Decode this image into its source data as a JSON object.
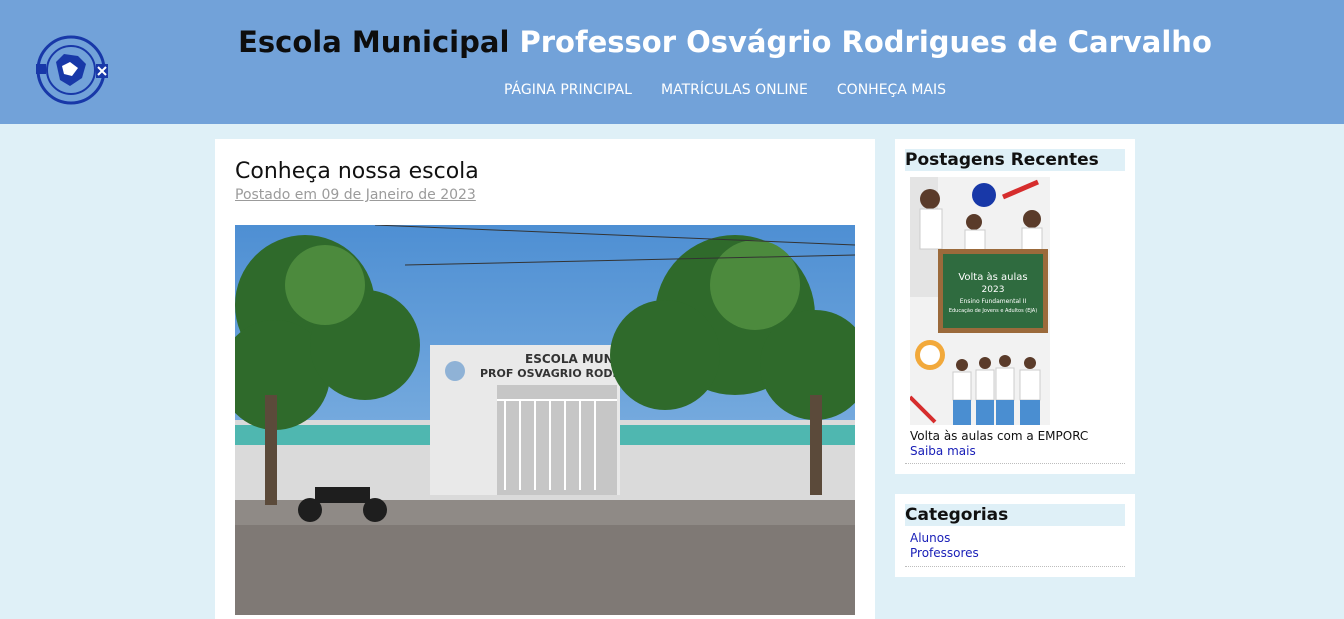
{
  "header": {
    "title_part1": "Escola Municipal",
    "title_part2": "Professor Osvágrio Rodrigues de Carvalho",
    "nav": [
      "PÁGINA PRINCIPAL",
      "MATRÍCULAS ONLINE",
      "CONHEÇA MAIS"
    ]
  },
  "post": {
    "title": "Conheça nossa escola",
    "date": "Postado em 09 de Janeiro de 2023",
    "photo_sign": [
      "ESCOLA MUNIC",
      "PROF OSVAGRIO RODRIGUE"
    ]
  },
  "recent": {
    "title": "Postagens Recentes",
    "thumb_text": [
      "Volta às aulas",
      "2023",
      "Ensino Fundamental II",
      "Educação de Jovens e Adultos (EJA)"
    ],
    "post_title": "Volta às aulas com a EMPORC",
    "link": "Saiba mais"
  },
  "categories": {
    "title": "Categorias",
    "items": [
      "Alunos",
      "Professores"
    ]
  }
}
